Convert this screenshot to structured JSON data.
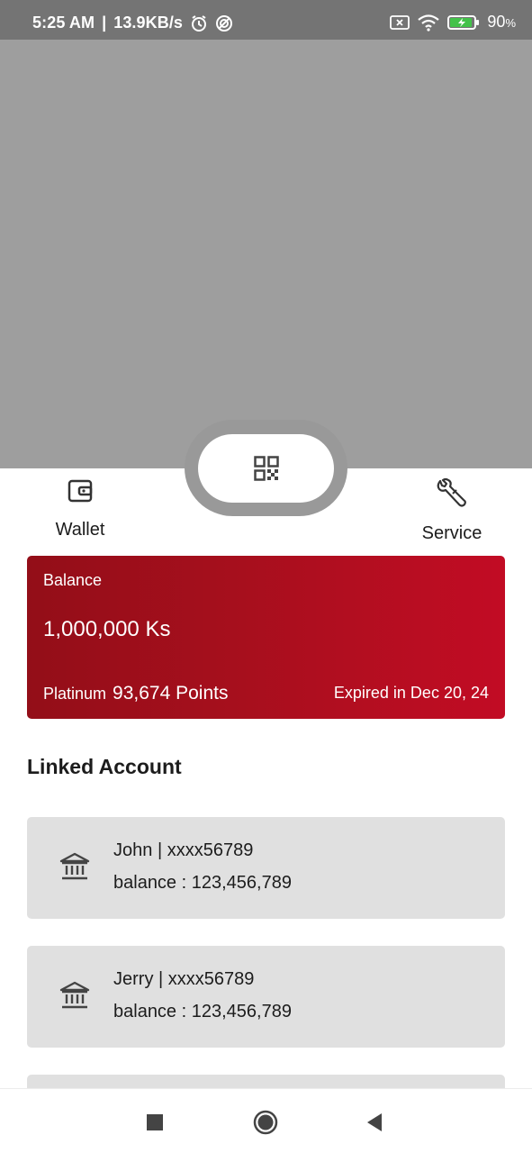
{
  "status_bar": {
    "time": "5:25 AM",
    "separator": "|",
    "speed": "13.9KB/s",
    "battery_percent": "90",
    "battery_suffix": "%"
  },
  "nav": {
    "wallet_label": "Wallet",
    "service_label": "Service",
    "qr_icon": "qr-code-icon"
  },
  "balance_card": {
    "label": "Balance",
    "amount": "1,000,000 Ks",
    "tier": "Platinum",
    "points": "93,674 Points",
    "expiry": "Expired in Dec 20, 24",
    "colors": {
      "start": "#930e18",
      "end": "#c20c24"
    }
  },
  "linked_accounts": {
    "title": "Linked Account",
    "items": [
      {
        "name": "John",
        "number": "xxxx56789",
        "separator": "|",
        "balance_label": "balance :",
        "balance": "123,456,789",
        "icon": "bank-icon"
      },
      {
        "name": "Jerry",
        "number": "xxxx56789",
        "separator": "|",
        "balance_label": "balance :",
        "balance": "123,456,789",
        "icon": "bank-icon"
      }
    ]
  }
}
